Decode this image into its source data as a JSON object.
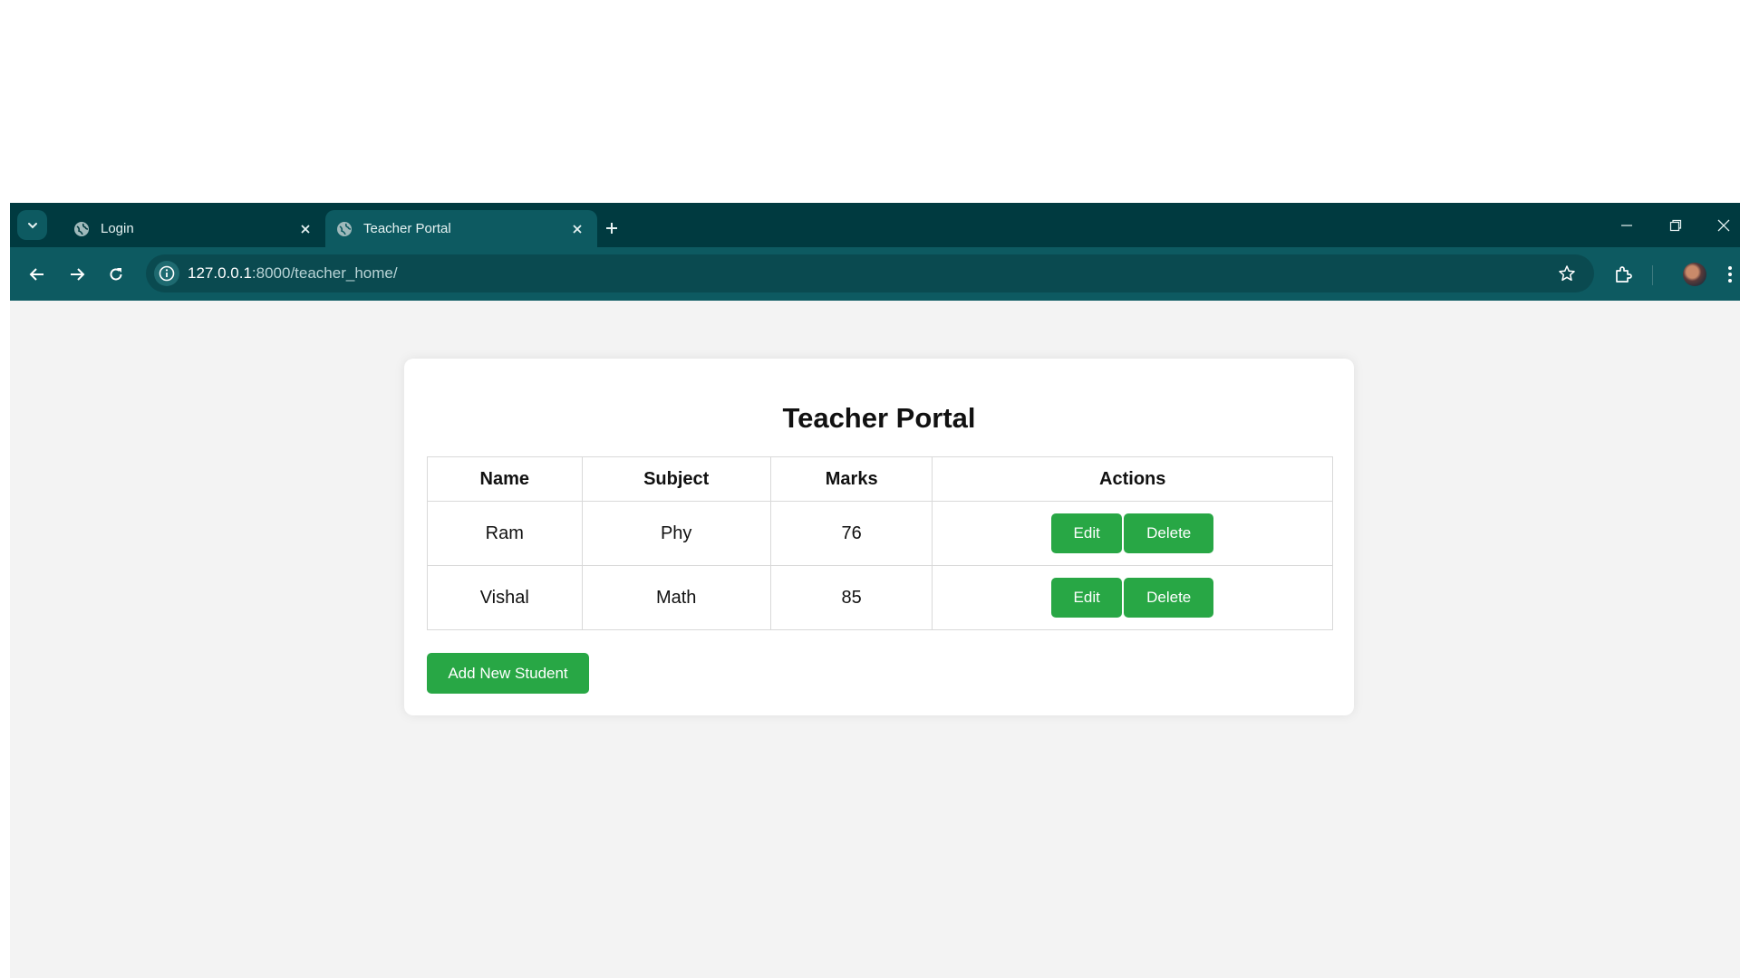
{
  "browser": {
    "tabs": [
      {
        "title": "Login",
        "active": false
      },
      {
        "title": "Teacher Portal",
        "active": true
      }
    ],
    "url_host": "127.0.0.1",
    "url_rest": ":8000/teacher_home/"
  },
  "page": {
    "title": "Teacher Portal",
    "table": {
      "headers": [
        "Name",
        "Subject",
        "Marks",
        "Actions"
      ],
      "rows": [
        {
          "name": "Ram",
          "subject": "Phy",
          "marks": "76",
          "edit_label": "Edit",
          "delete_label": "Delete"
        },
        {
          "name": "Vishal",
          "subject": "Math",
          "marks": "85",
          "edit_label": "Edit",
          "delete_label": "Delete"
        }
      ]
    },
    "add_button_label": "Add New Student"
  },
  "colors": {
    "accent_green": "#28a745",
    "browser_frame": "#003a40",
    "toolbar": "#0d5a61"
  }
}
